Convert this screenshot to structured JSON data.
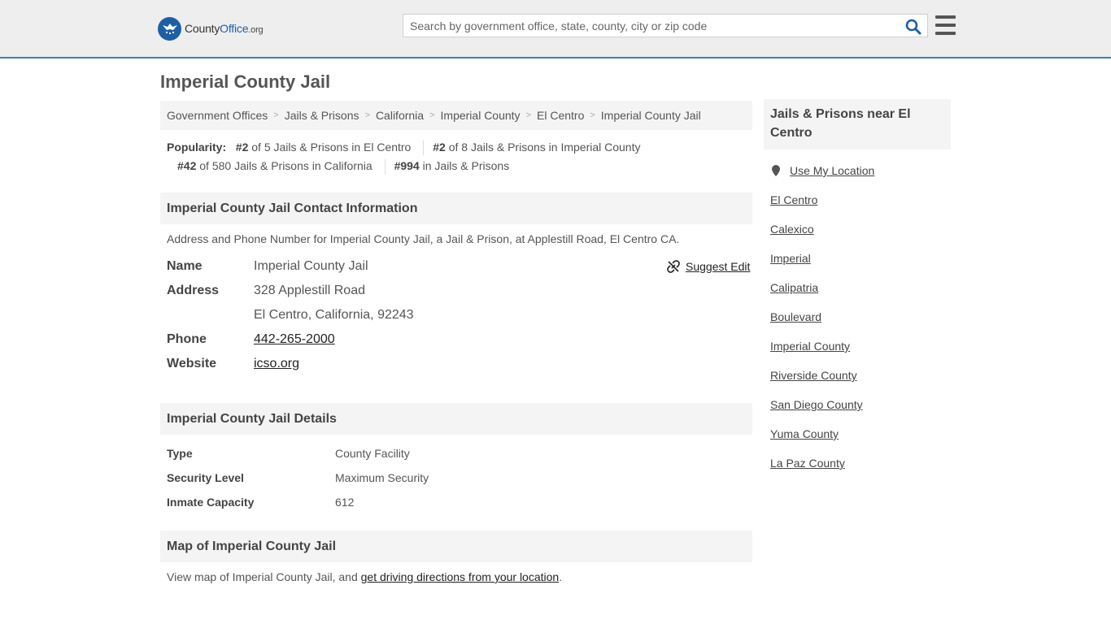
{
  "header": {
    "logo": {
      "part1": "County",
      "part2": "Office",
      "part3": ".org"
    },
    "search_placeholder": "Search by government office, state, county, city or zip code"
  },
  "page_title": "Imperial County Jail",
  "breadcrumb": [
    "Government Offices",
    "Jails & Prisons",
    "California",
    "Imperial County",
    "El Centro",
    "Imperial County Jail"
  ],
  "popularity": {
    "label": "Popularity:",
    "ranks": [
      {
        "rank": "#2",
        "text": "of 5 Jails & Prisons in El Centro"
      },
      {
        "rank": "#2",
        "text": "of 8 Jails & Prisons in Imperial County"
      },
      {
        "rank": "#42",
        "text": "of 580 Jails & Prisons in California"
      },
      {
        "rank": "#994",
        "text": "in Jails & Prisons"
      }
    ]
  },
  "contact": {
    "heading": "Imperial County Jail Contact Information",
    "description": "Address and Phone Number for Imperial County Jail, a Jail & Prison, at Applestill Road, El Centro CA.",
    "suggest_edit": "Suggest Edit",
    "name_label": "Name",
    "name": "Imperial County Jail",
    "address_label": "Address",
    "address_line1": "328 Applestill Road",
    "address_line2": "El Centro, California, 92243",
    "phone_label": "Phone",
    "phone": "442-265-2000",
    "website_label": "Website",
    "website": "icso.org"
  },
  "details": {
    "heading": "Imperial County Jail Details",
    "rows": [
      {
        "label": "Type",
        "value": "County Facility"
      },
      {
        "label": "Security Level",
        "value": "Maximum Security"
      },
      {
        "label": "Inmate Capacity",
        "value": "612"
      }
    ]
  },
  "map": {
    "heading": "Map of Imperial County Jail",
    "text_before": "View map of Imperial County Jail, and ",
    "link": "get driving directions from your location",
    "text_after": "."
  },
  "sidebar": {
    "heading": "Jails & Prisons near El Centro",
    "use_location": "Use My Location",
    "links": [
      "El Centro",
      "Calexico",
      "Imperial",
      "Calipatria",
      "Boulevard",
      "Imperial County",
      "Riverside County",
      "San Diego County",
      "Yuma County",
      "La Paz County"
    ]
  },
  "colors": {
    "accent": "#1d5fa5",
    "header_bg": "#eeeeee",
    "header_border": "#3a7bc8",
    "panel_bg": "#f4f4f4"
  }
}
